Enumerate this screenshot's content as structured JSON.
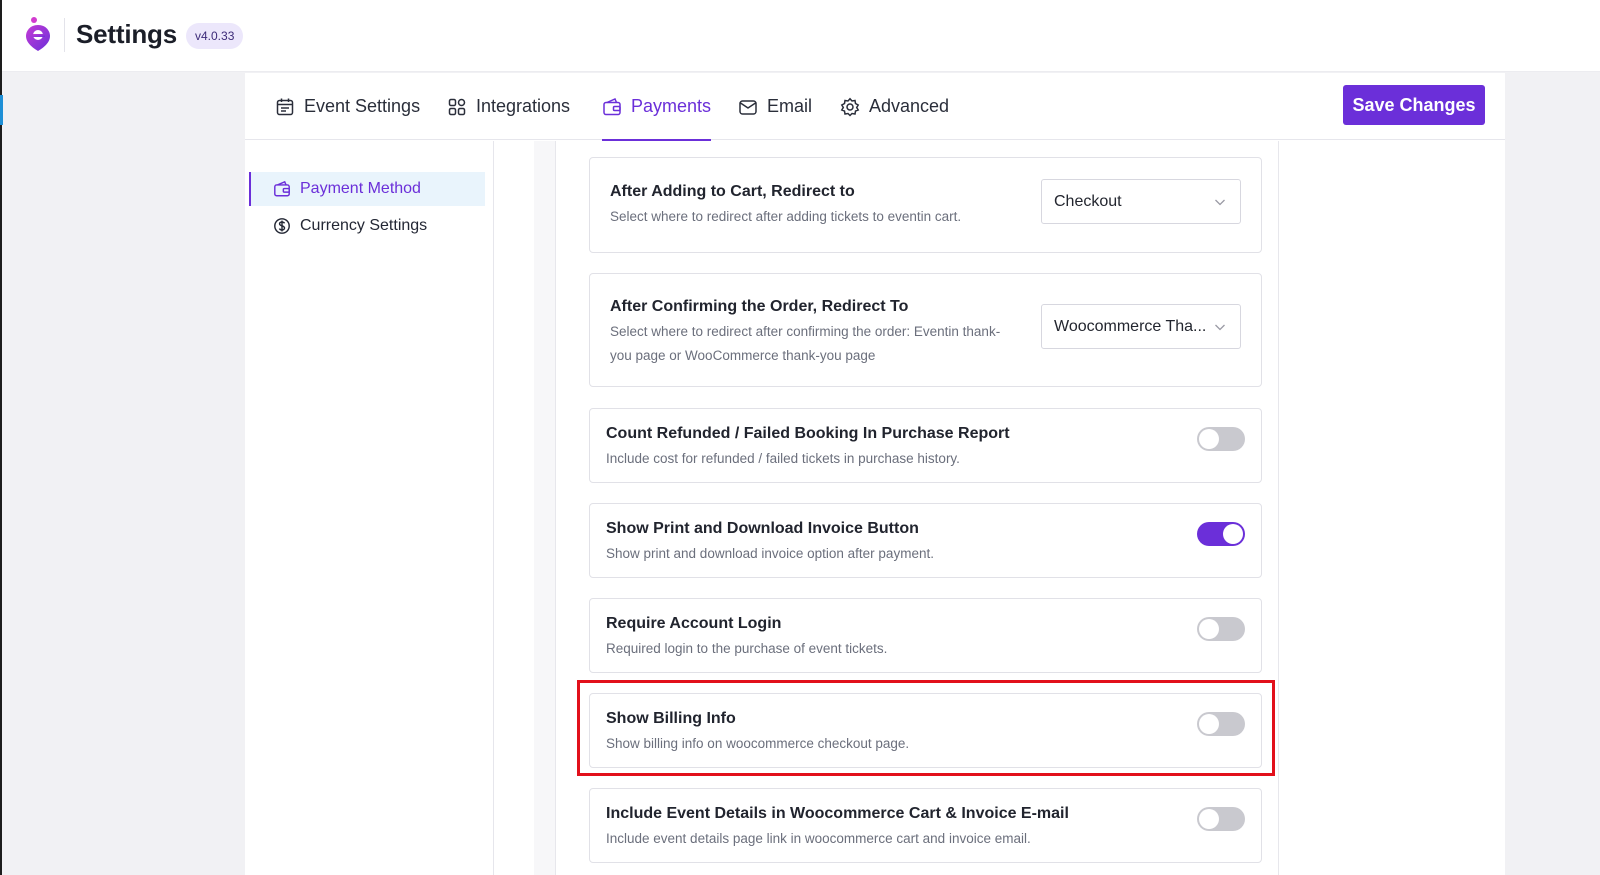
{
  "header": {
    "title": "Settings",
    "version": "v4.0.33"
  },
  "tabs": [
    {
      "label": "Event Settings",
      "icon": "calendar-icon",
      "active": false
    },
    {
      "label": "Integrations",
      "icon": "grid-icon",
      "active": false
    },
    {
      "label": "Payments",
      "icon": "wallet-icon",
      "active": true
    },
    {
      "label": "Email",
      "icon": "envelope-icon",
      "active": false
    },
    {
      "label": "Advanced",
      "icon": "gear-icon",
      "active": false
    }
  ],
  "save_label": "Save Changes",
  "sidebar": {
    "items": [
      {
        "label": "Payment Method",
        "icon": "wallet-icon",
        "active": true
      },
      {
        "label": "Currency Settings",
        "icon": "dollar-circle-icon",
        "active": false
      }
    ]
  },
  "settings": {
    "redirect_cart": {
      "title": "After Adding to Cart, Redirect to",
      "desc": "Select where to redirect after adding tickets to eventin cart.",
      "value": "Checkout"
    },
    "redirect_order": {
      "title": "After Confirming the Order, Redirect To",
      "desc_line1": "Select where to redirect after confirming the order: Eventin thank-",
      "desc_line2": "you page or WooCommerce thank-you page",
      "value": "Woocommerce Tha..."
    },
    "toggles": [
      {
        "title": "Count Refunded / Failed Booking In Purchase Report",
        "desc": "Include cost for refunded / failed tickets in purchase history.",
        "on": false
      },
      {
        "title": "Show Print and Download Invoice Button",
        "desc": "Show print and download invoice option after payment.",
        "on": true
      },
      {
        "title": "Require Account Login",
        "desc": "Required login to the purchase of event tickets.",
        "on": false
      },
      {
        "title": "Show Billing Info",
        "desc": "Show billing info on woocommerce checkout page.",
        "on": false
      },
      {
        "title": "Include Event Details in Woocommerce Cart & Invoice E-mail",
        "desc": "Include event details page link in woocommerce cart and invoice email.",
        "on": false
      }
    ]
  },
  "colors": {
    "accent": "#6b2fd9",
    "highlight": "#e2101b",
    "toggle_off": "#c9c9cf"
  }
}
